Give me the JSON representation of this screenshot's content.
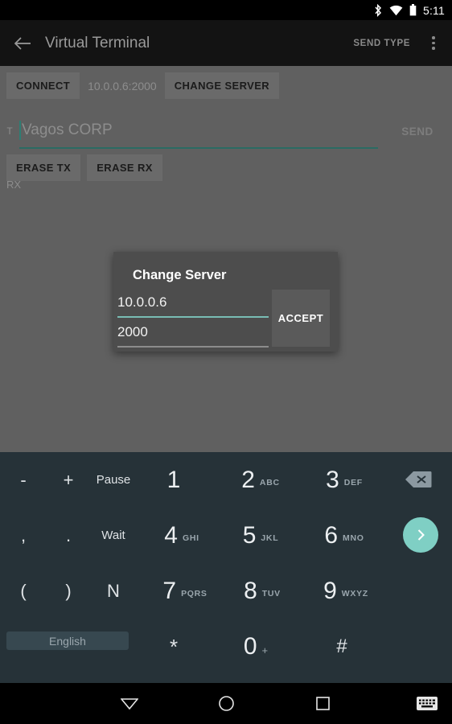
{
  "statusbar": {
    "time": "5:11",
    "icons": [
      "bluetooth-icon",
      "wifi-icon",
      "battery-icon"
    ]
  },
  "appbar": {
    "back": "back-arrow-icon",
    "title": "Virtual Terminal",
    "send_type_label": "SEND TYPE",
    "overflow": "overflow-menu-icon"
  },
  "main": {
    "connect_label": "CONNECT",
    "server_address": "10.0.0.6:2000",
    "change_server_label": "CHANGE SERVER",
    "tx_label": "T",
    "tx_placeholder": "Vagos CORP",
    "tx_value": "",
    "send_label": "SEND",
    "erase_tx_label": "ERASE TX",
    "erase_rx_label": "ERASE RX",
    "rx_label": "RX"
  },
  "dialog": {
    "title": "Change Server",
    "host_value": "10.0.0.6",
    "port_value": "2000",
    "accept_label": "ACCEPT"
  },
  "keyboard": {
    "language_label": "English",
    "backspace": "backspace-icon",
    "enter": "send-chevron-icon",
    "rows": [
      [
        {
          "main": "-",
          "sub": "",
          "type": "sym"
        },
        {
          "main": "+",
          "sub": "",
          "type": "sym"
        },
        {
          "main": "Pause",
          "sub": "",
          "type": "word"
        },
        {
          "main": "1",
          "sub": "",
          "type": "digit"
        },
        {
          "main": "2",
          "sub": "ABC",
          "type": "digit"
        },
        {
          "main": "3",
          "sub": "DEF",
          "type": "digit"
        }
      ],
      [
        {
          "main": ",",
          "sub": "",
          "type": "sym"
        },
        {
          "main": ".",
          "sub": "",
          "type": "sym"
        },
        {
          "main": "Wait",
          "sub": "",
          "type": "word"
        },
        {
          "main": "4",
          "sub": "GHI",
          "type": "digit"
        },
        {
          "main": "5",
          "sub": "JKL",
          "type": "digit"
        },
        {
          "main": "6",
          "sub": "MNO",
          "type": "digit"
        }
      ],
      [
        {
          "main": "(",
          "sub": "",
          "type": "sym"
        },
        {
          "main": ")",
          "sub": "",
          "type": "sym"
        },
        {
          "main": "N",
          "sub": "",
          "type": "word"
        },
        {
          "main": "7",
          "sub": "PQRS",
          "type": "digit"
        },
        {
          "main": "8",
          "sub": "TUV",
          "type": "digit"
        },
        {
          "main": "9",
          "sub": "WXYZ",
          "type": "digit"
        }
      ],
      [
        {
          "main": "*",
          "sub": "",
          "type": "sym"
        },
        {
          "main": "0",
          "sub": "+",
          "type": "digit"
        },
        {
          "main": "#",
          "sub": "",
          "type": "sym"
        }
      ]
    ]
  },
  "navbar": {
    "back": "hide-keyboard-icon",
    "home": "home-circle-icon",
    "recents": "recents-square-icon",
    "switch_keyboard": "keyboard-switch-icon"
  },
  "colors": {
    "accent_teal": "#7fcfc4",
    "field_underline_focused": "#2e7d73",
    "keyboard_bg": "#263238",
    "dialog_bg": "#4d4d4d",
    "scrim": "#606060"
  }
}
